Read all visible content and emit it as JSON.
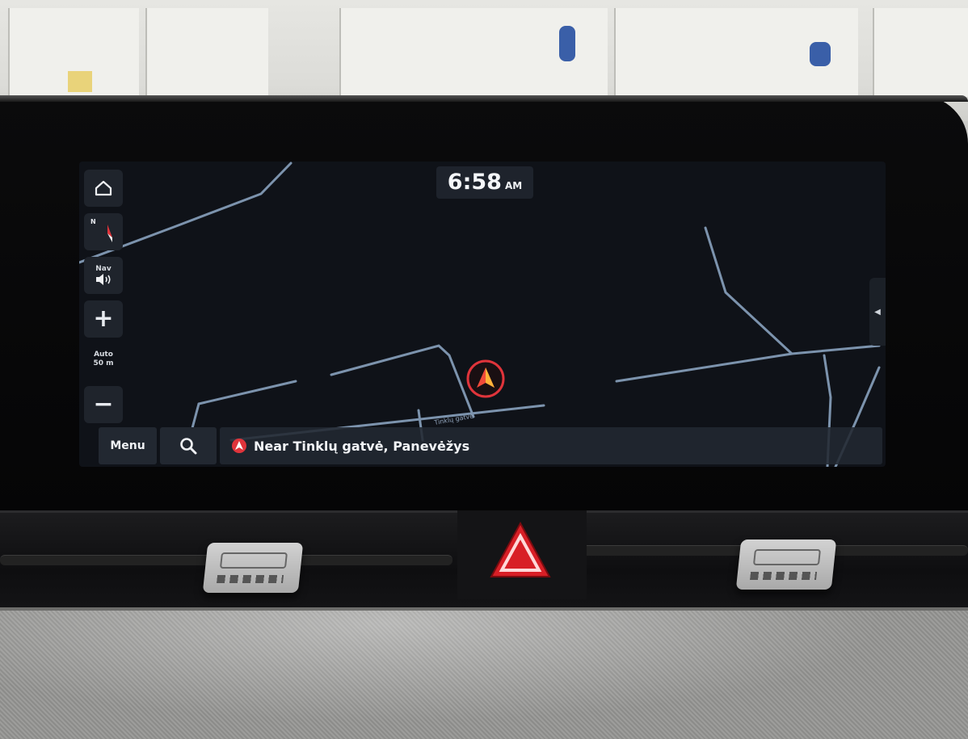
{
  "clock": {
    "time": "6:58",
    "period": "AM"
  },
  "sidebar": {
    "compass_letter": "N",
    "nav_volume_label": "Nav",
    "zoom_in_symbol": "+",
    "zoom_out_symbol": "−",
    "zoom_mode_label": "Auto",
    "zoom_scale_label": "50 m"
  },
  "bottom_bar": {
    "menu_label": "Menu",
    "location_text": "Near Tinklų gatvė, Panevėžys"
  },
  "map": {
    "road_label": "Tinklų gatvė"
  },
  "colors": {
    "map_background": "#0f1218",
    "road": "#7c93ad",
    "marker_red": "#e0343b",
    "button_bg": "#1f242c",
    "hazard_red": "#d81f26"
  },
  "icons": {
    "home": "home-icon",
    "compass": "compass-icon",
    "volume": "speaker-icon",
    "search": "search-icon",
    "position": "navigation-arrow-icon",
    "hazard": "hazard-triangle-icon"
  }
}
